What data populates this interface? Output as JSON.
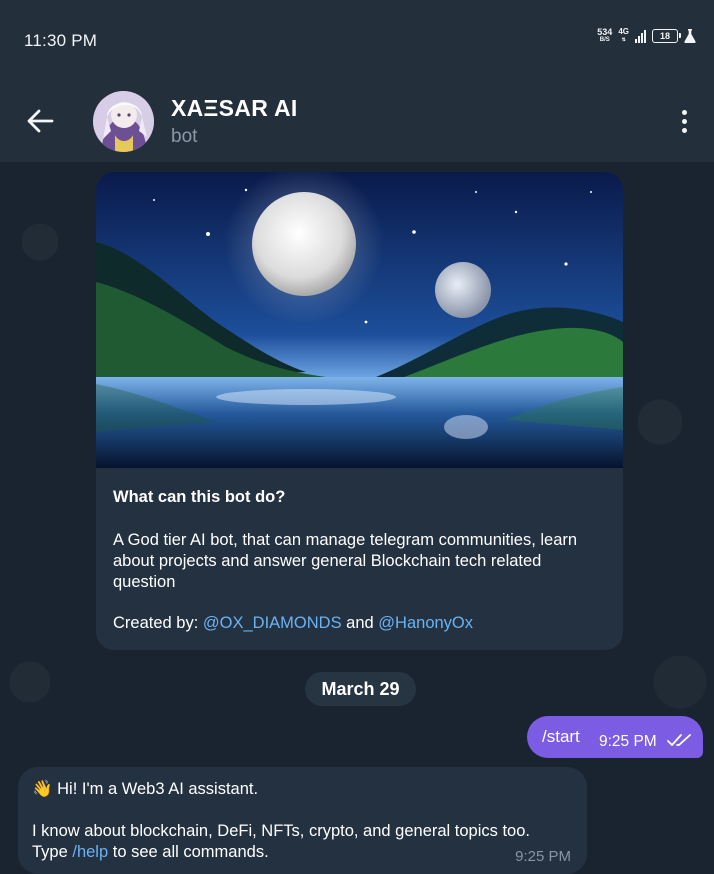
{
  "status_bar": {
    "time": "11:30 PM",
    "net_speed": "534",
    "net_speed_unit": "B/S",
    "network_type": "4G",
    "battery": "18"
  },
  "header": {
    "title": "XAΞSAR AI",
    "subtitle": "bot"
  },
  "intro": {
    "heading": "What can this bot do?",
    "description": "A God tier AI bot, that can manage telegram communities, learn about projects and answer general Blockchain tech related question",
    "created_label": "Created by:",
    "creator_1": "@OX_DIAMONDS",
    "and_label": "and",
    "creator_2": "@HanonyOx"
  },
  "date_divider": "March 29",
  "messages": {
    "outgoing": {
      "text": "/start",
      "time": "9:25 PM"
    },
    "incoming": {
      "emoji": "👋",
      "greeting": "Hi! I'm a Web3 AI assistant.",
      "line2": "I know about blockchain, DeFi, NFTs, crypto, and general topics too.",
      "line3_prefix": "Type",
      "line3_link": "/help",
      "line3_suffix": "to see all commands.",
      "time": "9:25 PM"
    }
  },
  "colors": {
    "accent_purple": "#7c5ce3",
    "link_blue": "#6ab3f3",
    "bubble_bg": "#243140",
    "header_bg": "#232f3b"
  }
}
